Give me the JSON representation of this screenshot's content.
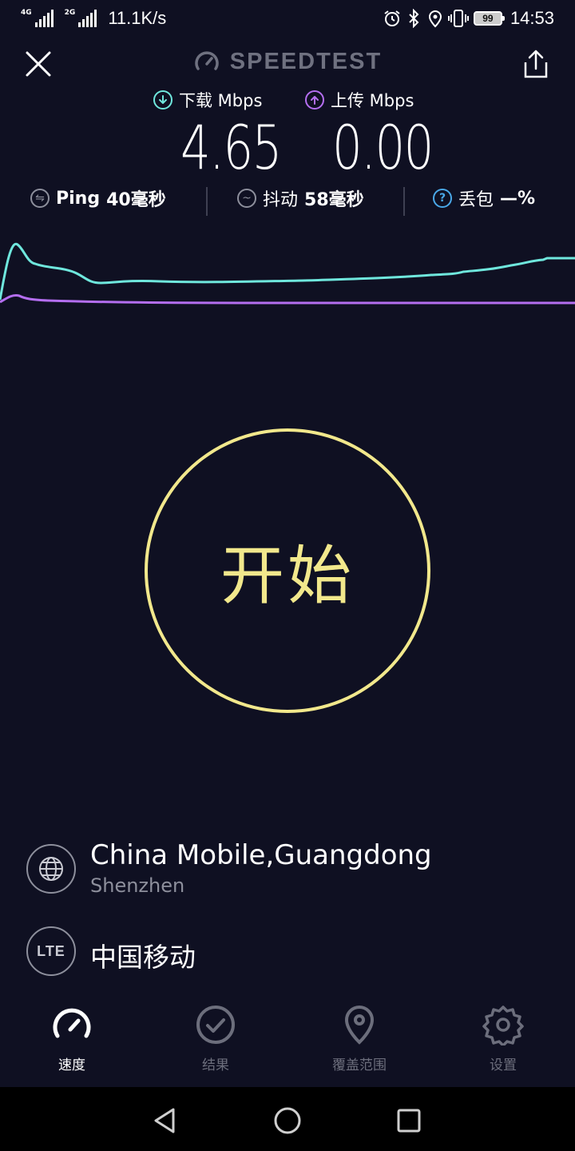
{
  "status_bar": {
    "network_1": "4G",
    "network_2": "2G",
    "net_speed": "11.1K/s",
    "battery": "99",
    "time": "14:53"
  },
  "header": {
    "title": "SPEEDTEST"
  },
  "speeds": {
    "download_label": "下载 Mbps",
    "download_value": "4.65",
    "upload_label": "上传 Mbps",
    "upload_value": "0.00",
    "download_color": "#6fe7dd",
    "upload_color": "#b46ef0"
  },
  "stats": {
    "ping_label": "Ping",
    "ping_value": "40毫秒",
    "jitter_label": "抖动",
    "jitter_value": "58毫秒",
    "loss_label": "丢包",
    "loss_value": "—%"
  },
  "start_button": {
    "label": "开始",
    "color": "#f2e88c"
  },
  "server": {
    "name": "China Mobile,Guangdong",
    "city": "Shenzhen"
  },
  "provider": {
    "badge": "LTE",
    "name": "中国移动"
  },
  "tabs": [
    {
      "label": "速度",
      "icon": "speedometer-icon",
      "active": true
    },
    {
      "label": "结果",
      "icon": "check-circle-icon",
      "active": false
    },
    {
      "label": "覆盖范围",
      "icon": "map-pin-icon",
      "active": false
    },
    {
      "label": "设置",
      "icon": "gear-icon",
      "active": false
    }
  ]
}
